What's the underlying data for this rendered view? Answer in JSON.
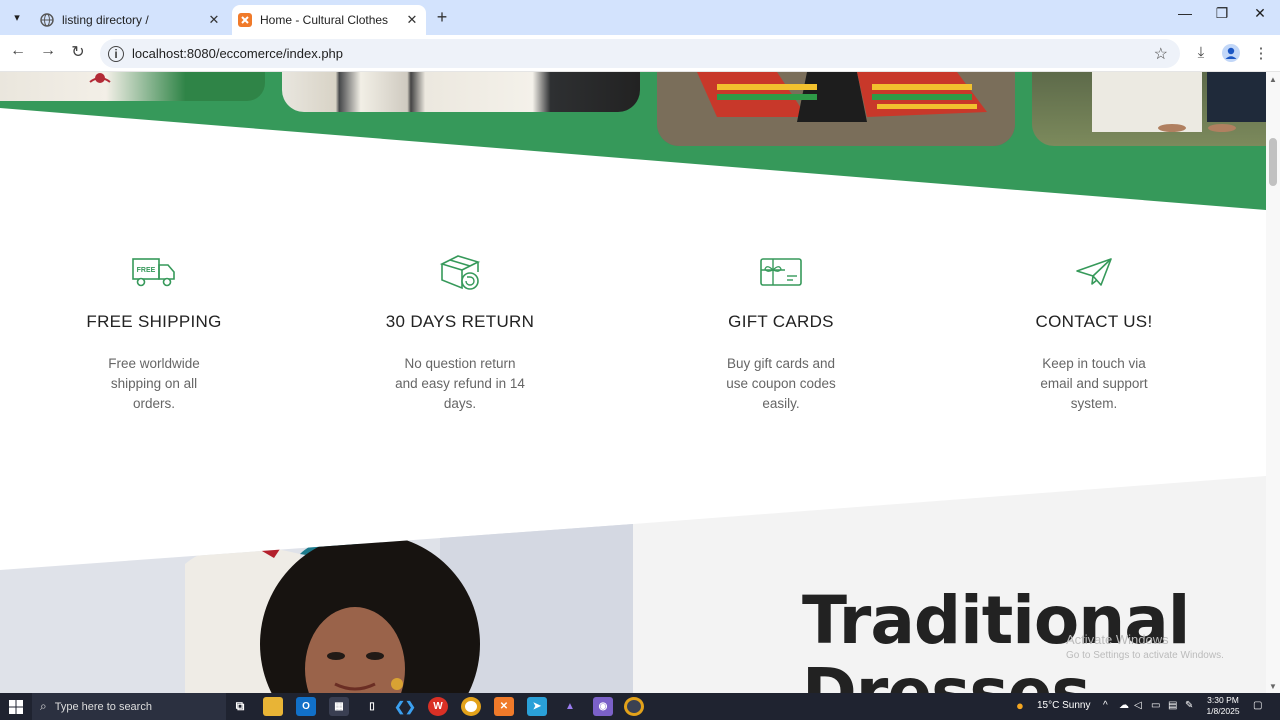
{
  "browser": {
    "tabs": [
      {
        "title": "listing directory /",
        "active": false
      },
      {
        "title": "Home - Cultural Clothes",
        "active": true
      }
    ],
    "url": "localhost:8080/eccomerce/index.php"
  },
  "colors": {
    "accent_green": "#36995a",
    "light_gray": "#f3f3f3",
    "tab_bar": "#d3e3fd"
  },
  "features": [
    {
      "icon": "free-shipping-truck-icon",
      "title": "FREE SHIPPING",
      "text": "Free worldwide shipping on all orders."
    },
    {
      "icon": "return-box-icon",
      "title": "30 DAYS RETURN",
      "text": "No question return and easy refund in 14 days."
    },
    {
      "icon": "gift-card-icon",
      "title": "GIFT CARDS",
      "text": "Buy gift cards and use coupon codes easily."
    },
    {
      "icon": "paper-plane-icon",
      "title": "CONTACT US!",
      "text": "Keep in touch via email and support system."
    }
  ],
  "hero": {
    "title_line1": "Traditional",
    "title_line2": "Dresses"
  },
  "watermark": {
    "line1": "Activate Windows",
    "line2": "Go to Settings to activate Windows."
  },
  "taskbar": {
    "search_placeholder": "Type here to search",
    "weather": "15°C  Sunny",
    "time": "3:30 PM",
    "date": "1/8/2025"
  }
}
